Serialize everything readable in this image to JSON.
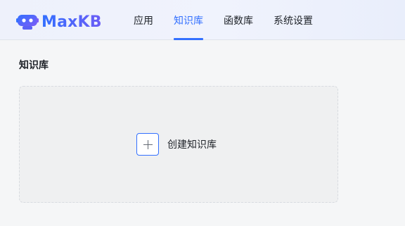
{
  "brand": {
    "name": "MaxKB",
    "icon": "robot-logo-icon",
    "accent": "#3370ff"
  },
  "nav": {
    "tabs": [
      {
        "label": "应用",
        "active": false
      },
      {
        "label": "知识库",
        "active": true
      },
      {
        "label": "函数库",
        "active": false
      },
      {
        "label": "系统设置",
        "active": false
      }
    ]
  },
  "main": {
    "title": "知识库",
    "create_card": {
      "label": "创建知识库",
      "icon": "plus-icon"
    }
  }
}
